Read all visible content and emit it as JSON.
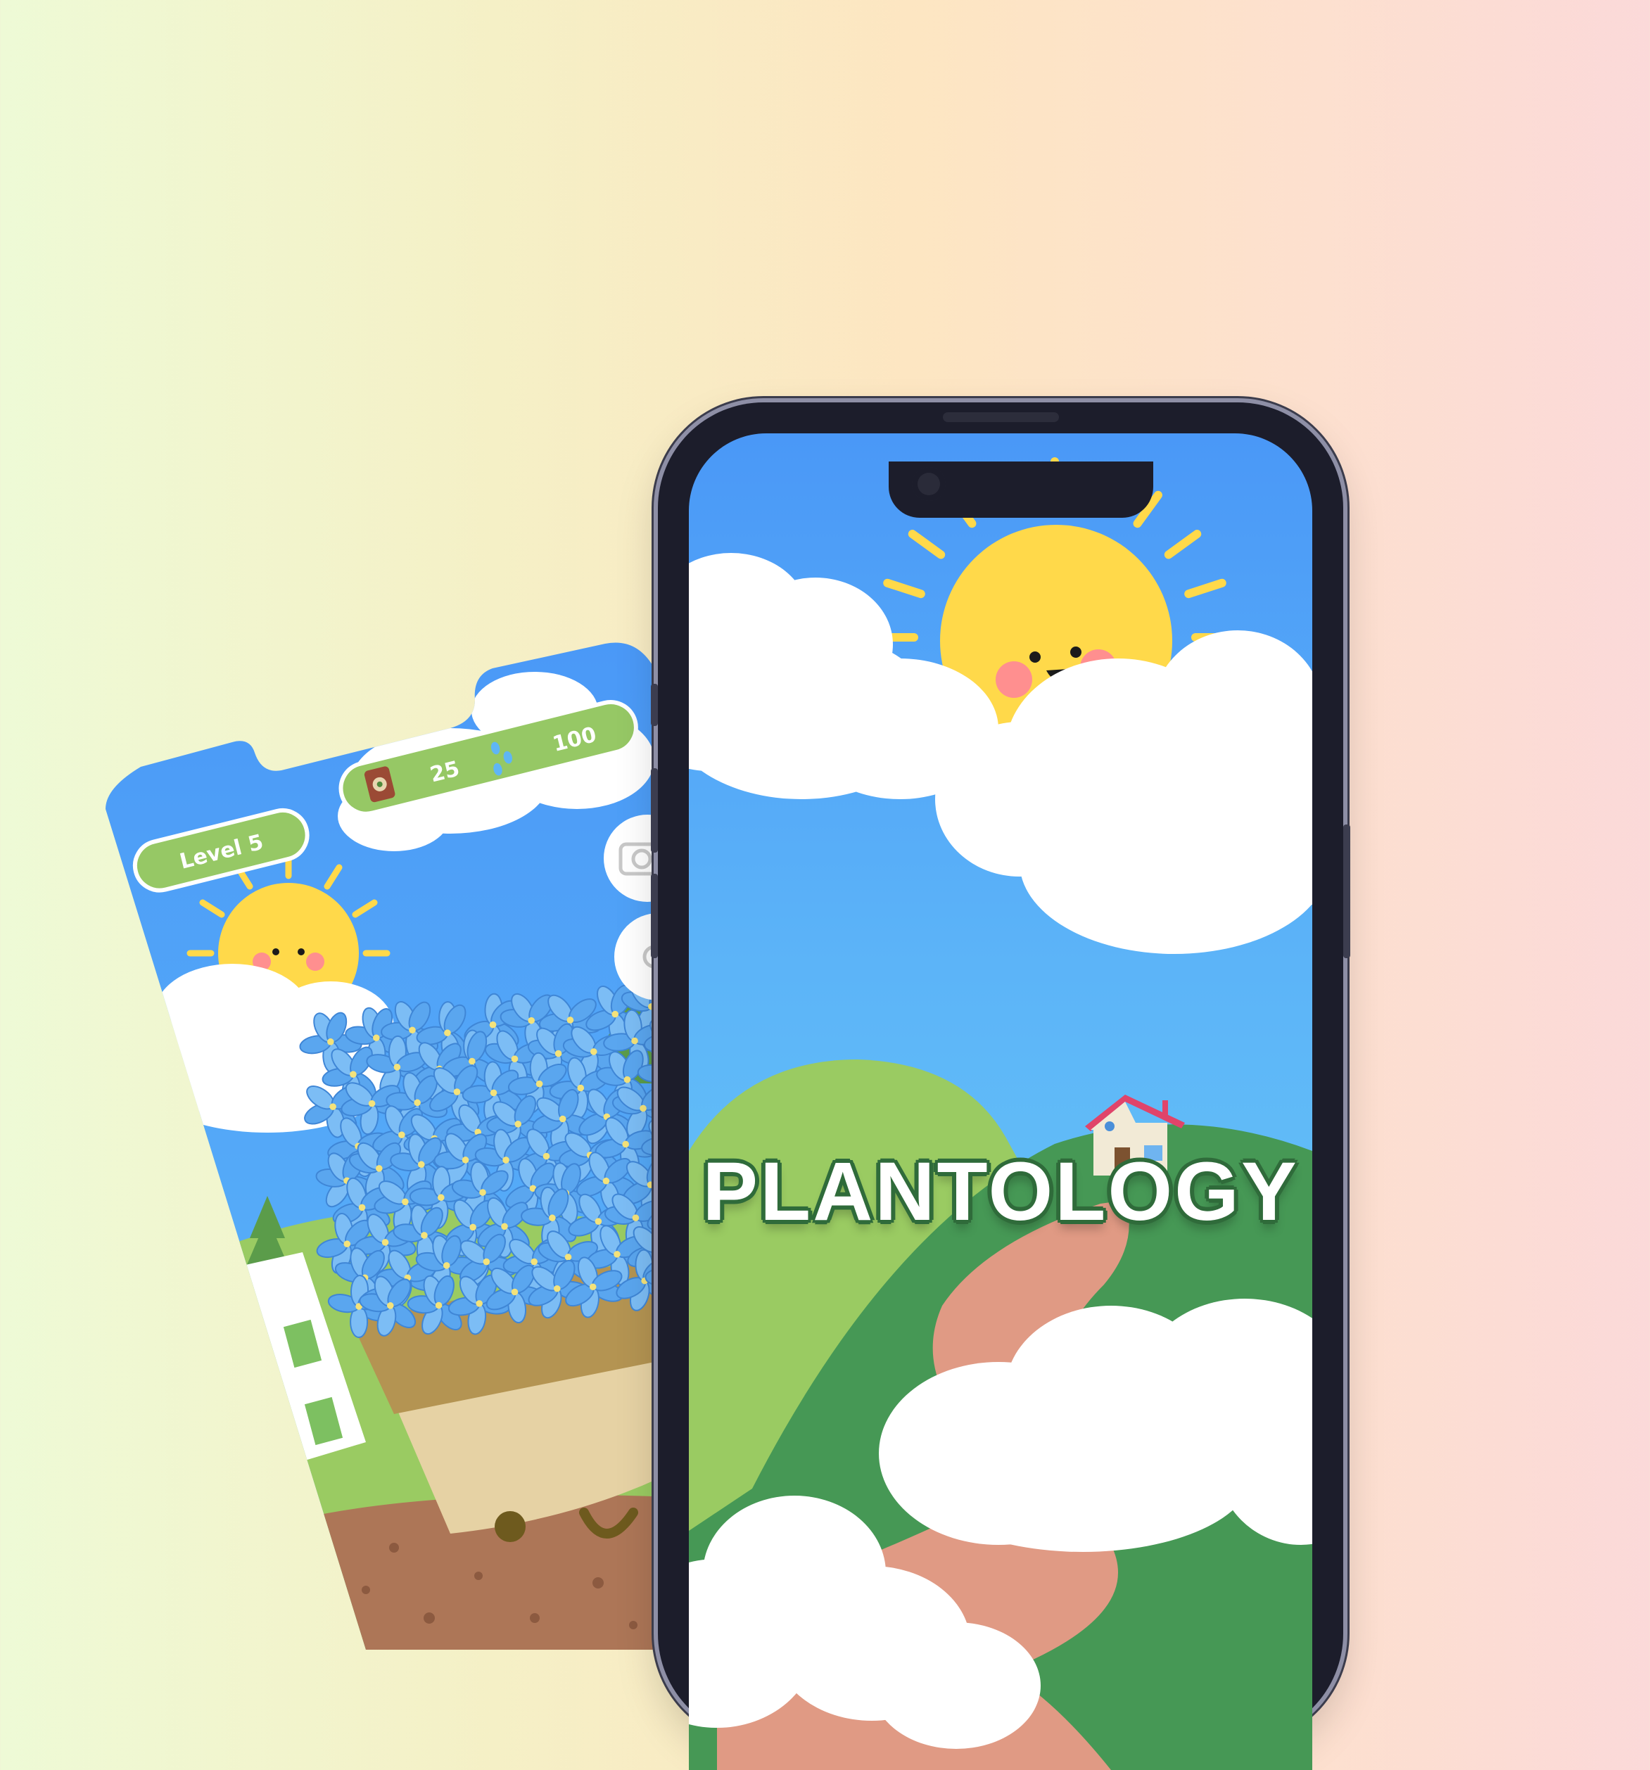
{
  "game": {
    "level_label": "Level 5",
    "seeds_count": "25",
    "water_count": "100",
    "icons": [
      "seed-bag-icon",
      "water-drops-icon",
      "camera-icon",
      "settings-icon"
    ]
  },
  "splash": {
    "title": "PLANTOLOGY"
  },
  "colors": {
    "sky_top": "#4a98f7",
    "sky_bottom": "#6fd3f4",
    "sun": "#ffd94a",
    "hud_green": "#96c865",
    "hill_light": "#9acb62",
    "hill_dark": "#469855",
    "path": "#e09a84",
    "title_outline": "#2f6b3a"
  }
}
